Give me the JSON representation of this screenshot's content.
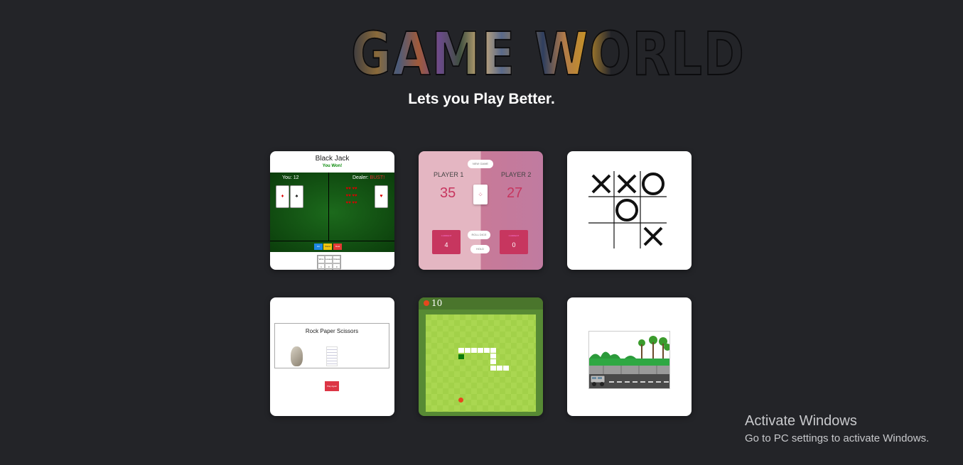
{
  "header": {
    "logo_text": "GAME WORLD",
    "tagline": "Lets you Play Better."
  },
  "cards": {
    "blackjack": {
      "title": "Black Jack",
      "result": "You Won!",
      "you_label": "You: 12",
      "dealer_label": "Dealer:",
      "dealer_status": "BUST!",
      "buttons": [
        "Hit",
        "Stand",
        "Deal"
      ],
      "stats_headers": [
        "Wins",
        "Losses",
        "Draws"
      ],
      "stats_values": [
        "1",
        "0",
        "0"
      ]
    },
    "pig": {
      "new_game": "NEW GAME",
      "player1": "PLAYER 1",
      "player2": "PLAYER 2",
      "score1": "35",
      "score2": "27",
      "current_label": "CURRENT",
      "current1": "4",
      "current2": "0",
      "roll": "ROLL DICE",
      "hold": "HOLD"
    },
    "tictactoe": {
      "cells": [
        "X",
        "X",
        "O",
        "",
        "O",
        "",
        "",
        "",
        "X"
      ]
    },
    "rps": {
      "title": "Rock Paper Scissors",
      "play_again": "Play Again"
    },
    "snake": {
      "score": "10"
    },
    "car": {}
  },
  "watermark": {
    "line1": "Activate Windows",
    "line2": "Go to PC settings to activate Windows."
  },
  "colors": {
    "background": "#232428",
    "accent_pink": "#c7365f",
    "snake_green": "#578a34"
  }
}
